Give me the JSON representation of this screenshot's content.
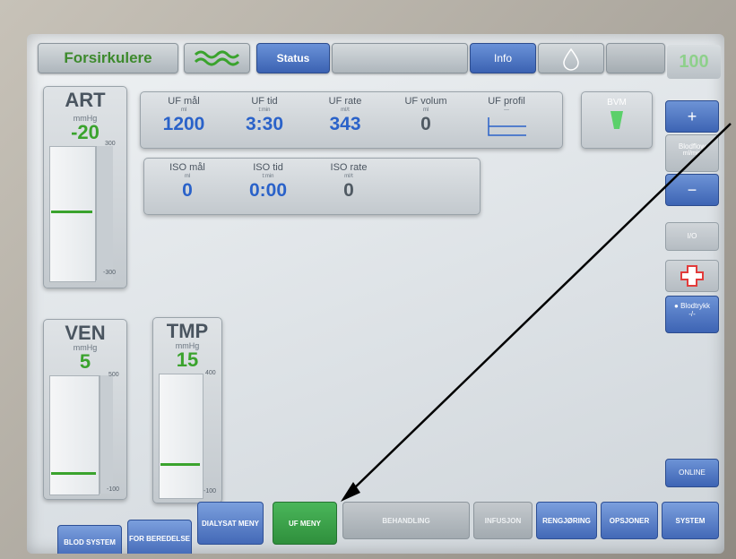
{
  "header": {
    "mode_title": "Forsirkulere",
    "status_label": "Status",
    "info_label": "Info",
    "corner_value": "100"
  },
  "gauges": {
    "art": {
      "title": "ART",
      "unit": "mmHg",
      "value": "-20",
      "scale_top": "300",
      "scale_bottom": "-300"
    },
    "ven": {
      "title": "VEN",
      "unit": "mmHg",
      "value": "5",
      "scale_top": "500",
      "scale_bottom": "-100"
    },
    "tmp": {
      "title": "TMP",
      "unit": "mmHg",
      "value": "15",
      "scale_top": "400",
      "scale_bottom": "-100"
    }
  },
  "uf_panel": {
    "items": [
      {
        "label": "UF mål",
        "unit": "ml",
        "value": "1200"
      },
      {
        "label": "UF tid",
        "unit": "t:min",
        "value": "3:30"
      },
      {
        "label": "UF rate",
        "unit": "ml/t",
        "value": "343"
      },
      {
        "label": "UF volum",
        "unit": "ml",
        "value": "0"
      },
      {
        "label": "UF profil",
        "unit": "---",
        "value": ""
      }
    ],
    "bvm_label": "BVM"
  },
  "iso_panel": {
    "items": [
      {
        "label": "ISO mål",
        "unit": "ml",
        "value": "0"
      },
      {
        "label": "ISO tid",
        "unit": "t:min",
        "value": "0:00"
      },
      {
        "label": "ISO rate",
        "unit": "ml/t",
        "value": "0"
      }
    ]
  },
  "side": {
    "plus": "+",
    "minus": "−",
    "blodflow": "Blodflow",
    "blodflow_unit": "ml/min",
    "io": "I/O",
    "blodtrykk": "Blodtrykk",
    "blodtrykk_val": "-/-",
    "online": "ONLINE"
  },
  "bottom": [
    {
      "label": "BLOD SYSTEM",
      "style": "blue"
    },
    {
      "label": "FOR BEREDELSE",
      "style": "blue"
    },
    {
      "label": "DIALYSAT MENY",
      "style": "blue"
    },
    {
      "label": "UF MENY",
      "style": "green"
    },
    {
      "label": "BEHANDLING",
      "style": "gray"
    },
    {
      "label": "INFUSJON",
      "style": "gray"
    },
    {
      "label": "RENGJØRING",
      "style": "blue"
    },
    {
      "label": "OPSJONER",
      "style": "blue"
    },
    {
      "label": "SYSTEM",
      "style": "blue"
    }
  ],
  "colors": {
    "accent_blue": "#3d64b4",
    "active_green": "#2f8f3c",
    "value_blue": "#2a62c9",
    "gauge_green": "#3aa32d"
  }
}
